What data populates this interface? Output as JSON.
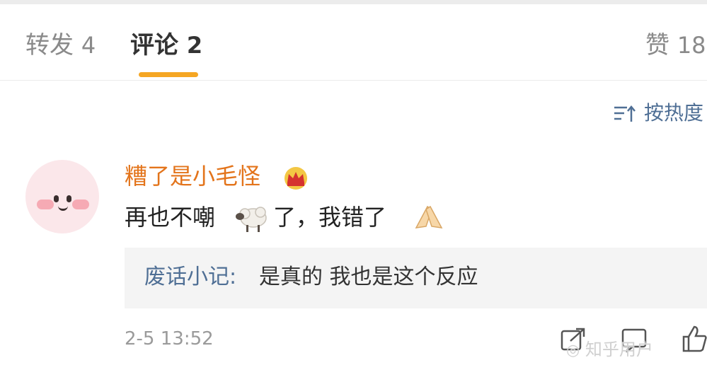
{
  "tabs": [
    {
      "label": "转发",
      "count": "4"
    },
    {
      "label": "评论",
      "count": "2"
    },
    {
      "label": "赞",
      "count": "18"
    }
  ],
  "accent_color": "#f5a623",
  "sort": {
    "label": "按热度",
    "icon": "sort-icon"
  },
  "comment": {
    "username": "糟了是小毛怪",
    "text_before": "再也不嘲",
    "text_after": "了，我错了",
    "emoji": [
      "sheep-emoji",
      "pray-hands-emoji"
    ],
    "badge_icon": "crown-icon",
    "reply": {
      "author": "废话小记:",
      "text": "是真的  我也是这个反应"
    },
    "timestamp": "2-5 13:52",
    "actions": [
      "share-icon",
      "comment-icon",
      "like-icon"
    ]
  },
  "watermark": {
    "text": "知乎用户"
  }
}
